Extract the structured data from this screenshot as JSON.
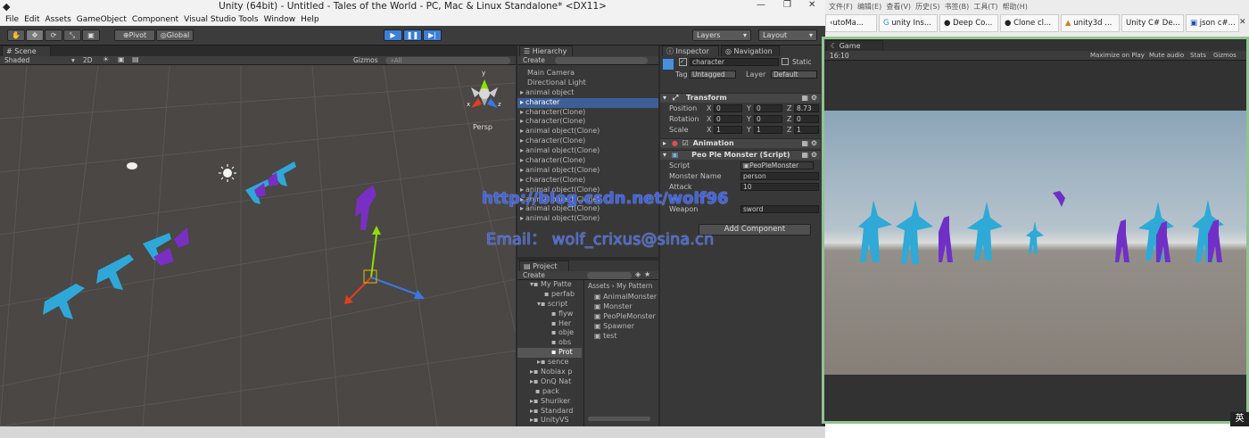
{
  "title": "Unity (64bit) - Untitled - Tales of the World - PC, Mac & Linux Standalone* <DX11>",
  "menu": [
    "File",
    "Edit",
    "Assets",
    "GameObject",
    "Component",
    "Visual Studio Tools",
    "Window",
    "Help"
  ],
  "toolbar": {
    "pivot": "Pivot",
    "global": "Global",
    "layers": "Layers",
    "layout": "Layout"
  },
  "scene": {
    "tab": "Scene",
    "shading": "Shaded",
    "mode_2d": "2D",
    "gizmos": "Gizmos",
    "search": "All",
    "persp": "Persp"
  },
  "hierarchy": {
    "tab": "Hierarchy",
    "create": "Create",
    "items": [
      "Main Camera",
      "Directional Light",
      "animal object",
      "character",
      "character(Clone)",
      "character(Clone)",
      "animal object(Clone)",
      "character(Clone)",
      "animal object(Clone)",
      "character(Clone)",
      "animal object(Clone)",
      "character(Clone)",
      "animal object(Clone)",
      "animal object(Clone)",
      "animal object(Clone)",
      "animal object(Clone)"
    ],
    "selected": 3
  },
  "project": {
    "tab": "Project",
    "create": "Create",
    "folders": [
      "My Patte",
      "perfab",
      "script",
      "flyw",
      "Her",
      "obje",
      "obs",
      "Prot",
      "sence",
      "Nobiax p",
      "OnQ Nat",
      "pack",
      "Shuriker",
      "Standard",
      "UnityVS"
    ],
    "breadcrumb": "Assets › My Pattern",
    "files": [
      "AnimalMonster",
      "Monster",
      "PeoPleMonster",
      "Spawner",
      "test"
    ]
  },
  "inspector": {
    "tab": "Inspector",
    "nav_tab": "Navigation",
    "name": "character",
    "static": "Static",
    "tag_label": "Tag",
    "tag": "Untagged",
    "layer_label": "Layer",
    "layer": "Default",
    "transform": "Transform",
    "position_label": "Position",
    "rotation_label": "Rotation",
    "scale_label": "Scale",
    "position": {
      "x": "0",
      "y": "0",
      "z": "8.73"
    },
    "rotation": {
      "x": "0",
      "y": "0",
      "z": "0"
    },
    "scale": {
      "x": "1",
      "y": "1",
      "z": "1"
    },
    "animation": "Animation",
    "script_component": "Peo Ple Monster (Script)",
    "script_label": "Script",
    "script": "PeoPleMonster",
    "monster_name_label": "Monster Name",
    "monster_name": "person",
    "attack_label": "Attack",
    "attack": "10",
    "weapon_label": "Weapon",
    "weapon": "sword",
    "add_component": "Add Component"
  },
  "game": {
    "tab": "Game",
    "aspect": "16:10",
    "maximize": "Maximize on Play",
    "mute": "Mute audio",
    "stats": "Stats",
    "gizmos": "Gizmos"
  },
  "browser": {
    "menu": [
      "文件(F)",
      "编辑(E)",
      "查看(V)",
      "历史(S)",
      "书签(B)",
      "工具(T)",
      "帮助(H)"
    ],
    "tabs": [
      "utoMa...",
      "unity Ins...",
      "Deep Co...",
      "Clone cl...",
      "unity3d ...",
      "Unity C# De...",
      "json c#..."
    ]
  },
  "watermark": {
    "url": "http://blog.csdn.net/wolf96",
    "email": "Email： wolf_crixus@sina.cn"
  },
  "ime": "英"
}
